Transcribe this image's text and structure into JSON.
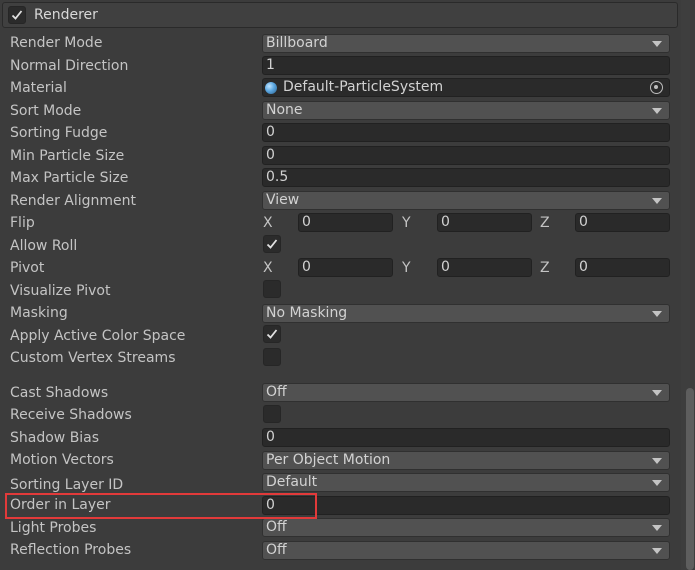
{
  "header": {
    "title": "Renderer",
    "enabled": true
  },
  "rows": {
    "render_mode": {
      "label": "Render Mode",
      "value": "Billboard"
    },
    "normal_direction": {
      "label": "Normal Direction",
      "value": "1"
    },
    "material": {
      "label": "Material",
      "value": "Default-ParticleSystem"
    },
    "sort_mode": {
      "label": "Sort Mode",
      "value": "None"
    },
    "sorting_fudge": {
      "label": "Sorting Fudge",
      "value": "0"
    },
    "min_particle_size": {
      "label": "Min Particle Size",
      "value": "0"
    },
    "max_particle_size": {
      "label": "Max Particle Size",
      "value": "0.5"
    },
    "render_alignment": {
      "label": "Render Alignment",
      "value": "View"
    },
    "flip": {
      "label": "Flip",
      "x_label": "X",
      "x": "0",
      "y_label": "Y",
      "y": "0",
      "z_label": "Z",
      "z": "0"
    },
    "allow_roll": {
      "label": "Allow Roll",
      "checked": true
    },
    "pivot": {
      "label": "Pivot",
      "x_label": "X",
      "x": "0",
      "y_label": "Y",
      "y": "0",
      "z_label": "Z",
      "z": "0"
    },
    "visualize_pivot": {
      "label": "Visualize Pivot",
      "checked": false
    },
    "masking": {
      "label": "Masking",
      "value": "No Masking"
    },
    "apply_active_color_space": {
      "label": "Apply Active Color Space",
      "checked": true
    },
    "custom_vertex_streams": {
      "label": "Custom Vertex Streams",
      "checked": false
    },
    "cast_shadows": {
      "label": "Cast Shadows",
      "value": "Off"
    },
    "receive_shadows": {
      "label": "Receive Shadows",
      "checked": false
    },
    "shadow_bias": {
      "label": "Shadow Bias",
      "value": "0"
    },
    "motion_vectors": {
      "label": "Motion Vectors",
      "value": "Per Object Motion"
    },
    "sorting_layer_id": {
      "label": "Sorting Layer ID",
      "value": "Default"
    },
    "order_in_layer": {
      "label": "Order in Layer",
      "value": "0"
    },
    "light_probes": {
      "label": "Light Probes",
      "value": "Off"
    },
    "reflection_probes": {
      "label": "Reflection Probes",
      "value": "Off"
    }
  },
  "icons": {
    "checkmark": "checkmark-icon",
    "material": "material-sphere-icon",
    "picker": "object-picker-icon"
  },
  "colors": {
    "background": "#3c3c3c",
    "field": "#2a2a2a",
    "dropdown": "#515151",
    "highlight": "#e23a3a"
  }
}
